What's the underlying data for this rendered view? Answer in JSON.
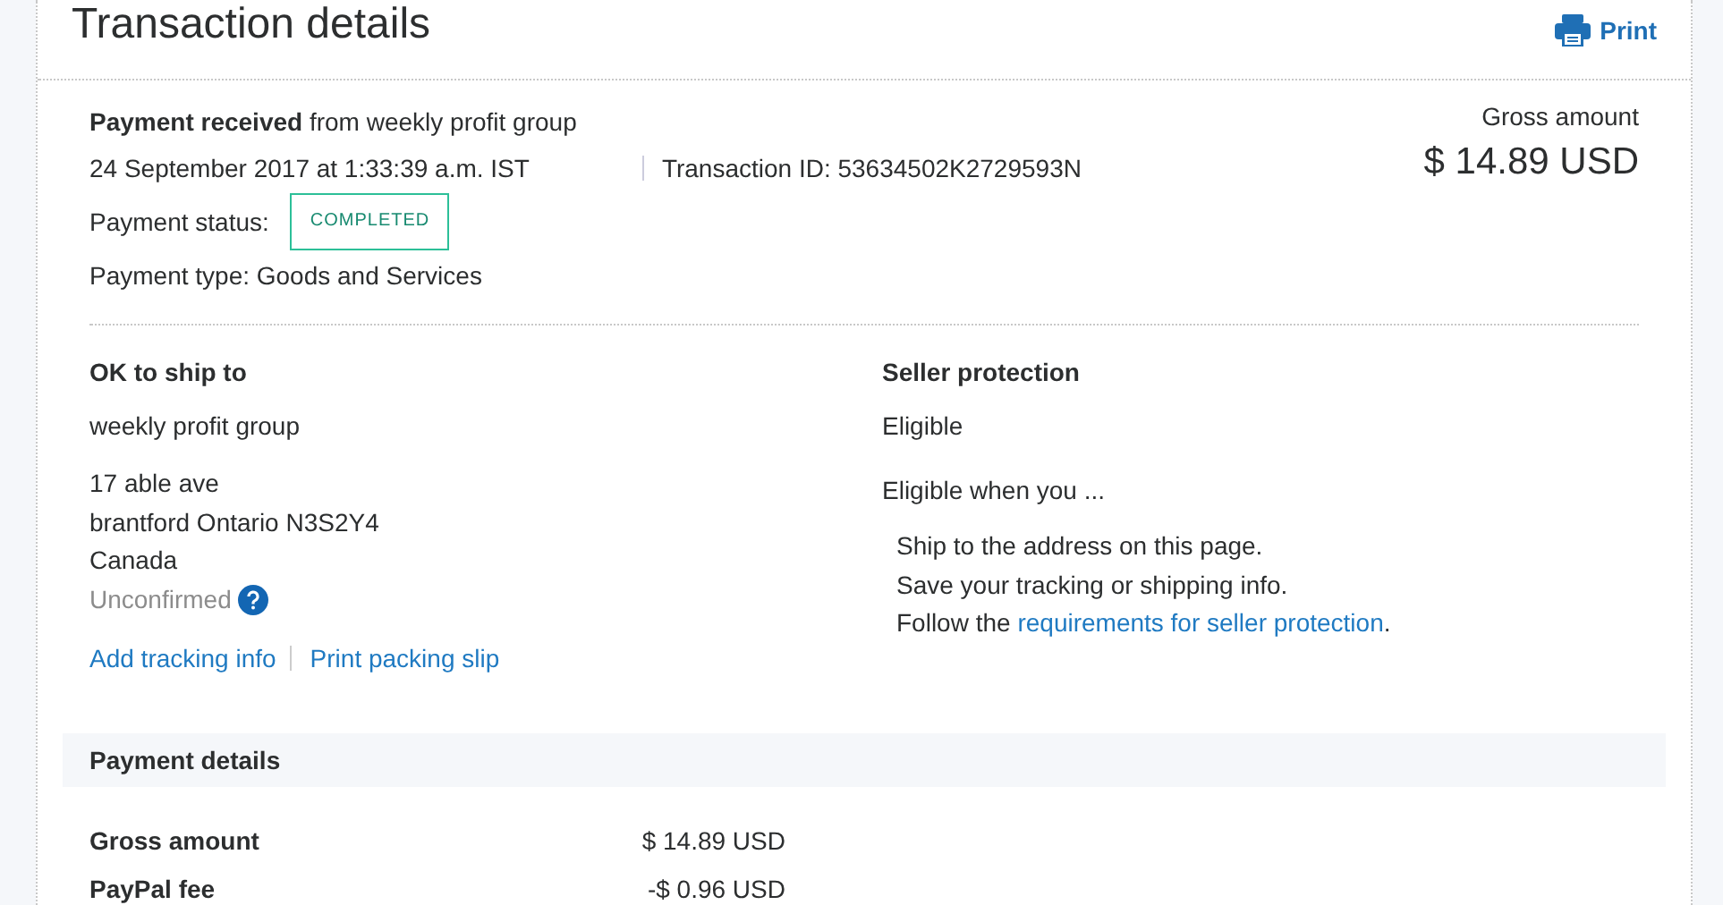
{
  "header": {
    "title": "Transaction details",
    "print_label": "Print"
  },
  "summary": {
    "headline": "**Payment received** from weekly profit group",
    "date": "24 September 2017 at 1:33:39 a.m. IST",
    "transaction_id": "Transaction ID: 53634502K2729593N",
    "status_label": "Payment status:",
    "status": "COMPLETED",
    "payment_type": "Payment type: Goods and Services",
    "amount_label": "Gross amount",
    "amount": "$ 14.89 USD"
  },
  "shipping": {
    "heading": "OK to ship to",
    "name": "weekly profit group",
    "address_lines": [
      "17 able ave",
      "brantford Ontario N3S2Y4",
      "Canada"
    ],
    "confirmation": "Unconfirmed",
    "links": [
      "Add tracking info",
      "Print packing slip"
    ]
  },
  "seller_protection": {
    "heading": "Seller protection",
    "status": "Eligible",
    "intro": "Eligible when you ...",
    "steps": [
      "Ship to the address on this page.",
      "Save your tracking or shipping info."
    ],
    "last_step": {
      "before": "Follow the ",
      "link": "requirements for seller protection",
      "after": "."
    }
  },
  "payment_details": {
    "heading": "Payment details",
    "rows": [
      {
        "label": "Gross amount",
        "value": "$ 14.89 USD"
      },
      {
        "label": "PayPal fee",
        "value": "-$ 0.96 USD"
      }
    ]
  }
}
